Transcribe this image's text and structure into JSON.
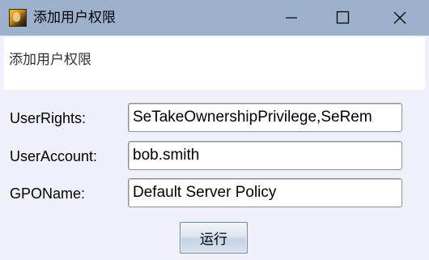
{
  "window": {
    "title": "添加用户权限",
    "icon": "app-icon",
    "controls": {
      "minimize_icon": "minimize-icon",
      "maximize_icon": "maximize-icon",
      "close_icon": "close-icon"
    }
  },
  "header": {
    "description": "添加用户权限"
  },
  "form": {
    "fields": [
      {
        "label": "UserRights:",
        "value": "SeTakeOwnershipPrivilege,SeRem"
      },
      {
        "label": "UserAccount:",
        "value": "bob.smith"
      },
      {
        "label": "GPOName:",
        "value": "Default Server Policy"
      }
    ]
  },
  "actions": {
    "run_label": "运行"
  },
  "colors": {
    "titlebar": "#9db0cc",
    "window_bg": "#eef1f9",
    "header_bg": "#ffffff"
  }
}
